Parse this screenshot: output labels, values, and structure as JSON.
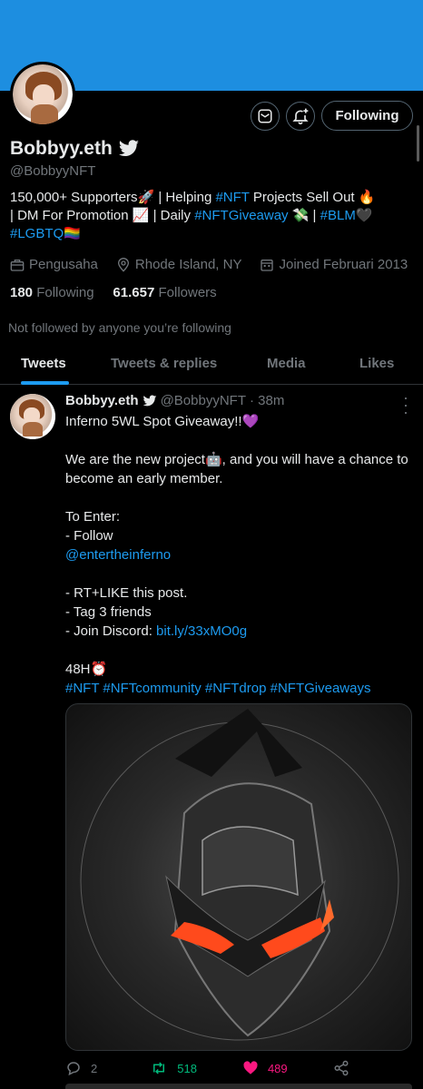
{
  "profile": {
    "display_name": "Bobbyy.eth",
    "handle": "@BobbyyNFT",
    "follow_button_label": "Following",
    "bio": {
      "line1_a": "150,000+ Supporters🚀 | Helping ",
      "line1_tag": "#NFT",
      "line1_b": " Projects Sell Out 🔥",
      "line2_a": "| DM For Promotion 📈 | Daily ",
      "line2_tag": "#NFTGiveaway",
      "line2_b": " 💸 | ",
      "line2_tag2": "#BLM",
      "line2_c": "🖤",
      "line3_tag": "#LGBTQ",
      "line3_b": "🏳️‍🌈"
    },
    "occupation": "Pengusaha",
    "location": "Rhode Island, NY",
    "joined": "Joined Februari 2013",
    "following_count": "180",
    "following_label": "Following",
    "followers_count": "61.657",
    "followers_label": "Followers",
    "not_followed_text": "Not followed by anyone you’re following"
  },
  "tabs": [
    {
      "label": "Tweets"
    },
    {
      "label": "Tweets & replies"
    },
    {
      "label": "Media"
    },
    {
      "label": "Likes"
    }
  ],
  "tweet": {
    "author_name": "Bobbyy.eth",
    "author_handle": "@BobbyyNFT",
    "time": "· 38m",
    "line1": "Inferno 5WL Spot Giveaway!!💜",
    "para2": "We are the new project🤖, and you will have a chance to become an early member.",
    "to_enter": "To Enter:",
    "follow_item": "- Follow",
    "mention": "@entertheinferno",
    "item_rt": "- RT+LIKE this post.",
    "item_tag": "- Tag 3 friends",
    "item_discord": "- Join Discord: ",
    "discord_link": "bit.ly/33xMO0g",
    "time_limit": "48H⏰",
    "hashtags": "#NFT #NFTcommunity #NFTdrop #NFTGiveaways",
    "reply_count": "2",
    "retweet_count": "518",
    "like_count": "489"
  },
  "colors": {
    "banner": "#1d8ee0",
    "accent": "#1d9bf0",
    "retweet": "#00ba7c",
    "like": "#f91880"
  }
}
